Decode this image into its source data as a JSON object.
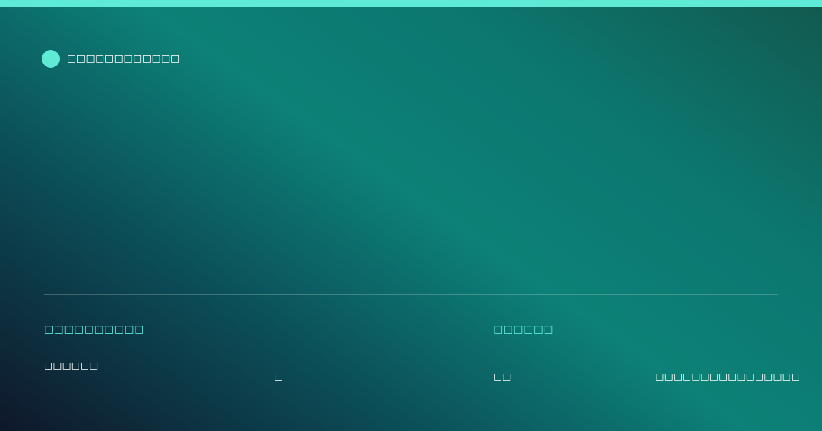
{
  "brand": {
    "name": "□□□□□□□□□□□□",
    "accent_color": "#5eead4"
  },
  "left_section": {
    "label": "□□□□□□□□□□",
    "value": "□□□□□□",
    "extra": "□"
  },
  "right_section": {
    "label": "□□□□□□",
    "value": "□□",
    "extra": "□□□□□□□□□□□□□□□□"
  }
}
